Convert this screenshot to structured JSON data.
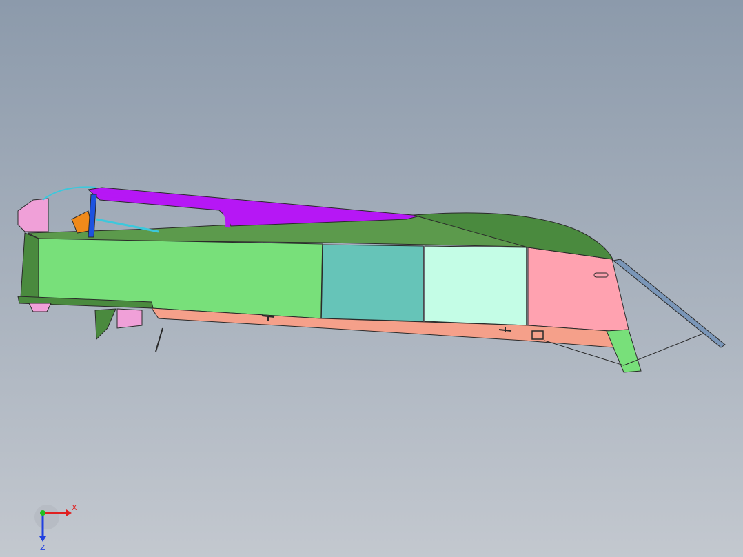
{
  "viewport": {
    "background_top": "#8c9aab",
    "background_bottom": "#c3c8cf"
  },
  "model": {
    "colors": {
      "hull_green": "#78e07a",
      "hull_dark_green": "#4a8a3e",
      "deck_green": "#5c9a4c",
      "bottom_salmon": "#f5a08a",
      "teal_panel": "#66c4b8",
      "mint_panel": "#c4fde6",
      "pink_panel": "#ffa2b0",
      "purple_strut": "#b617f5",
      "blue_rod": "#1c52e0",
      "orange_part": "#f08a1a",
      "cyan_tube": "#3cc8dc",
      "bracket_pink": "#f0a0d8",
      "steel_blue_plate": "#7a96b8",
      "outline": "#2a2a2a"
    }
  },
  "triad": {
    "x_label": "X",
    "z_label": "Z",
    "x_color": "#e02020",
    "y_color": "#20c020",
    "z_color": "#2040e0"
  }
}
